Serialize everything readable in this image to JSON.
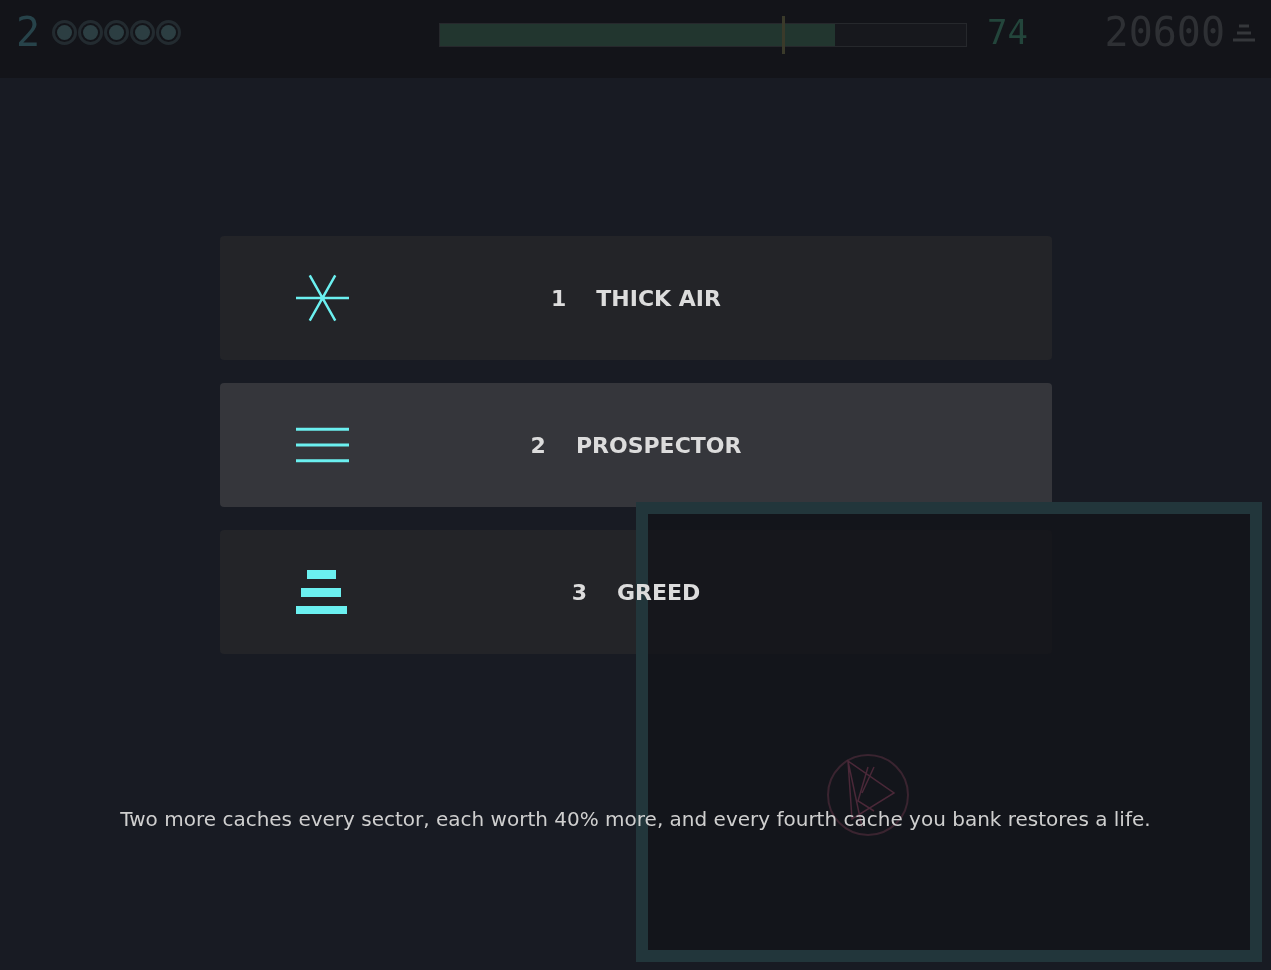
{
  "hud": {
    "sector": "2",
    "lives": [
      {
        "filled": true
      },
      {
        "filled": true
      },
      {
        "filled": true
      },
      {
        "filled": true
      },
      {
        "filled": true
      }
    ],
    "progress": {
      "level": 0.75,
      "target": {
        "level": 0.65
      }
    },
    "timer": "74",
    "score": "20600"
  },
  "choices": [
    {
      "kind": "asterisk",
      "number": "1",
      "label": "THICK AIR",
      "selected": false
    },
    {
      "kind": "lines",
      "number": "2",
      "label": "PROSPECTOR",
      "selected": true
    },
    {
      "kind": "stack",
      "number": "3",
      "label": "GREED",
      "selected": false
    }
  ],
  "description": "Two more caches every sector, each worth 40% more, and every fourth cache you bank restores a life."
}
